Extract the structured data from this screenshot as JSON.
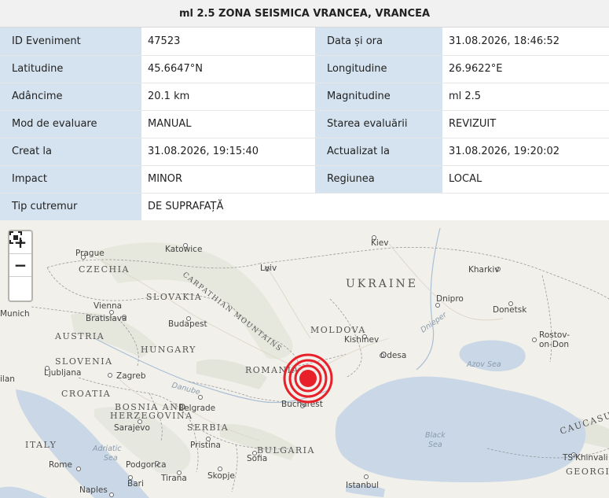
{
  "header": {
    "title": "ml 2.5 ZONA SEISMICA VRANCEA, VRANCEA"
  },
  "rows": [
    [
      "ID Eveniment",
      "47523",
      "Data și ora",
      "31.08.2026, 18:46:52"
    ],
    [
      "Latitudine",
      "45.6647°N",
      "Longitudine",
      "26.9622°E"
    ],
    [
      "Adâncime",
      "20.1 km",
      "Magnitudine",
      "ml 2.5"
    ],
    [
      "Mod de evaluare",
      "MANUAL",
      "Starea evaluării",
      "REVIZUIT"
    ],
    [
      "Creat la",
      "31.08.2026, 19:15:40",
      "Actualizat la",
      "31.08.2026, 19:20:02"
    ],
    [
      "Impact",
      "MINOR",
      "Regiunea",
      "LOCAL"
    ]
  ],
  "last_row": [
    "Tip cutremur",
    "DE SUPRAFAȚĂ"
  ],
  "map": {
    "zoom_in": "+",
    "zoom_out": "−",
    "fullscreen_icon": "fullscreen-icon",
    "marker_color": "#e8202a",
    "countries": {
      "ukraine": "UKRAINE",
      "czechia": "CZECHIA",
      "slovakia": "SLOVAKIA",
      "austria": "AUSTRIA",
      "hungary": "HUNGARY",
      "moldova": "MOLDOVA",
      "romania": "ROMANIA",
      "slovenia": "SLOVENIA",
      "croatia": "CROATIA",
      "bosnia": "BOSNIA AND",
      "herzegovina": "HERZEGOVINA",
      "serbia": "SERBIA",
      "bulgaria": "BULGARIA",
      "italy": "ITALY",
      "georgia": "GEORGI",
      "caucasus": "CAUCASUS"
    },
    "mountains": "CARPATHIAN MOUNTAINS",
    "cities": {
      "prague": "Prague",
      "katowice": "Katowice",
      "kiev": "Kiev",
      "lviv": "Lviv",
      "kharkiv": "Kharkiv",
      "vienna": "Vienna",
      "bratislava": "Bratislava",
      "budapest": "Budapest",
      "dnipro": "Dnipro",
      "donetsk": "Donetsk",
      "munich": "Munich",
      "kishinev": "Kishinev",
      "odesa": "Odesa",
      "rostov1": "Rostov-",
      "rostov2": "on-Don",
      "ljubljana": "Ljubljana",
      "zagreb": "Zagreb",
      "milan": "ilan",
      "belgrade": "Belgrade",
      "bucharest": "Bucharest",
      "sarajevo": "Sarajevo",
      "pristina": "Pristina",
      "sofia": "Sofia",
      "rome": "Rome",
      "podgorica": "Podgorica",
      "bari": "Bari",
      "tirana": "Tirana",
      "skopje": "Skopje",
      "naples": "Naples",
      "istanbul": "Istanbul",
      "tskhinvali": "TS'Khinvali"
    },
    "seas": {
      "dnieper": "Dnieper",
      "azov": "Azov Sea",
      "danube": "Danube",
      "adriatic1": "Adriatic",
      "adriatic2": "Sea",
      "black1": "Black",
      "black2": "Sea"
    }
  }
}
